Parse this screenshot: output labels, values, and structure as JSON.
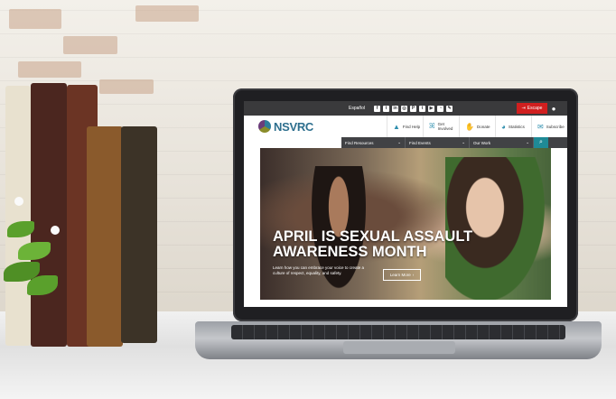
{
  "scene": {
    "colors": {
      "escape_red": "#d11f1f",
      "brand_blue": "#2e6f8e",
      "nav_dark": "#414245",
      "search_teal": "#1f8a96"
    }
  },
  "website": {
    "utility_bar": {
      "language_link": "Español",
      "social_icons": [
        "facebook-icon",
        "twitter-icon",
        "linkedin-icon",
        "instagram-icon",
        "pinterest-icon",
        "tumblr-icon",
        "youtube-icon",
        "rss-icon",
        "blog-icon"
      ],
      "escape_label": "Escape",
      "account_icon": "user-icon"
    },
    "header": {
      "logo_text": "NSVRC",
      "nav": [
        {
          "icon": "warning-icon",
          "label": "Find Help"
        },
        {
          "icon": "ribbon-icon",
          "label": "Get Involved"
        },
        {
          "icon": "hand-icon",
          "label": "Donate"
        },
        {
          "icon": "pie-chart-icon",
          "label": "Statistics"
        },
        {
          "icon": "envelope-icon",
          "label": "Subscribe"
        }
      ]
    },
    "dropdowns": [
      {
        "label": "Find Resources"
      },
      {
        "label": "Find Events"
      },
      {
        "label": "Our Work"
      }
    ],
    "hero": {
      "title": "April is Sexual Assault Awareness Month",
      "subtitle": "Learn how you can embrace your voice to create a culture of respect, equality, and safety.",
      "button_label": "Learn More"
    }
  }
}
